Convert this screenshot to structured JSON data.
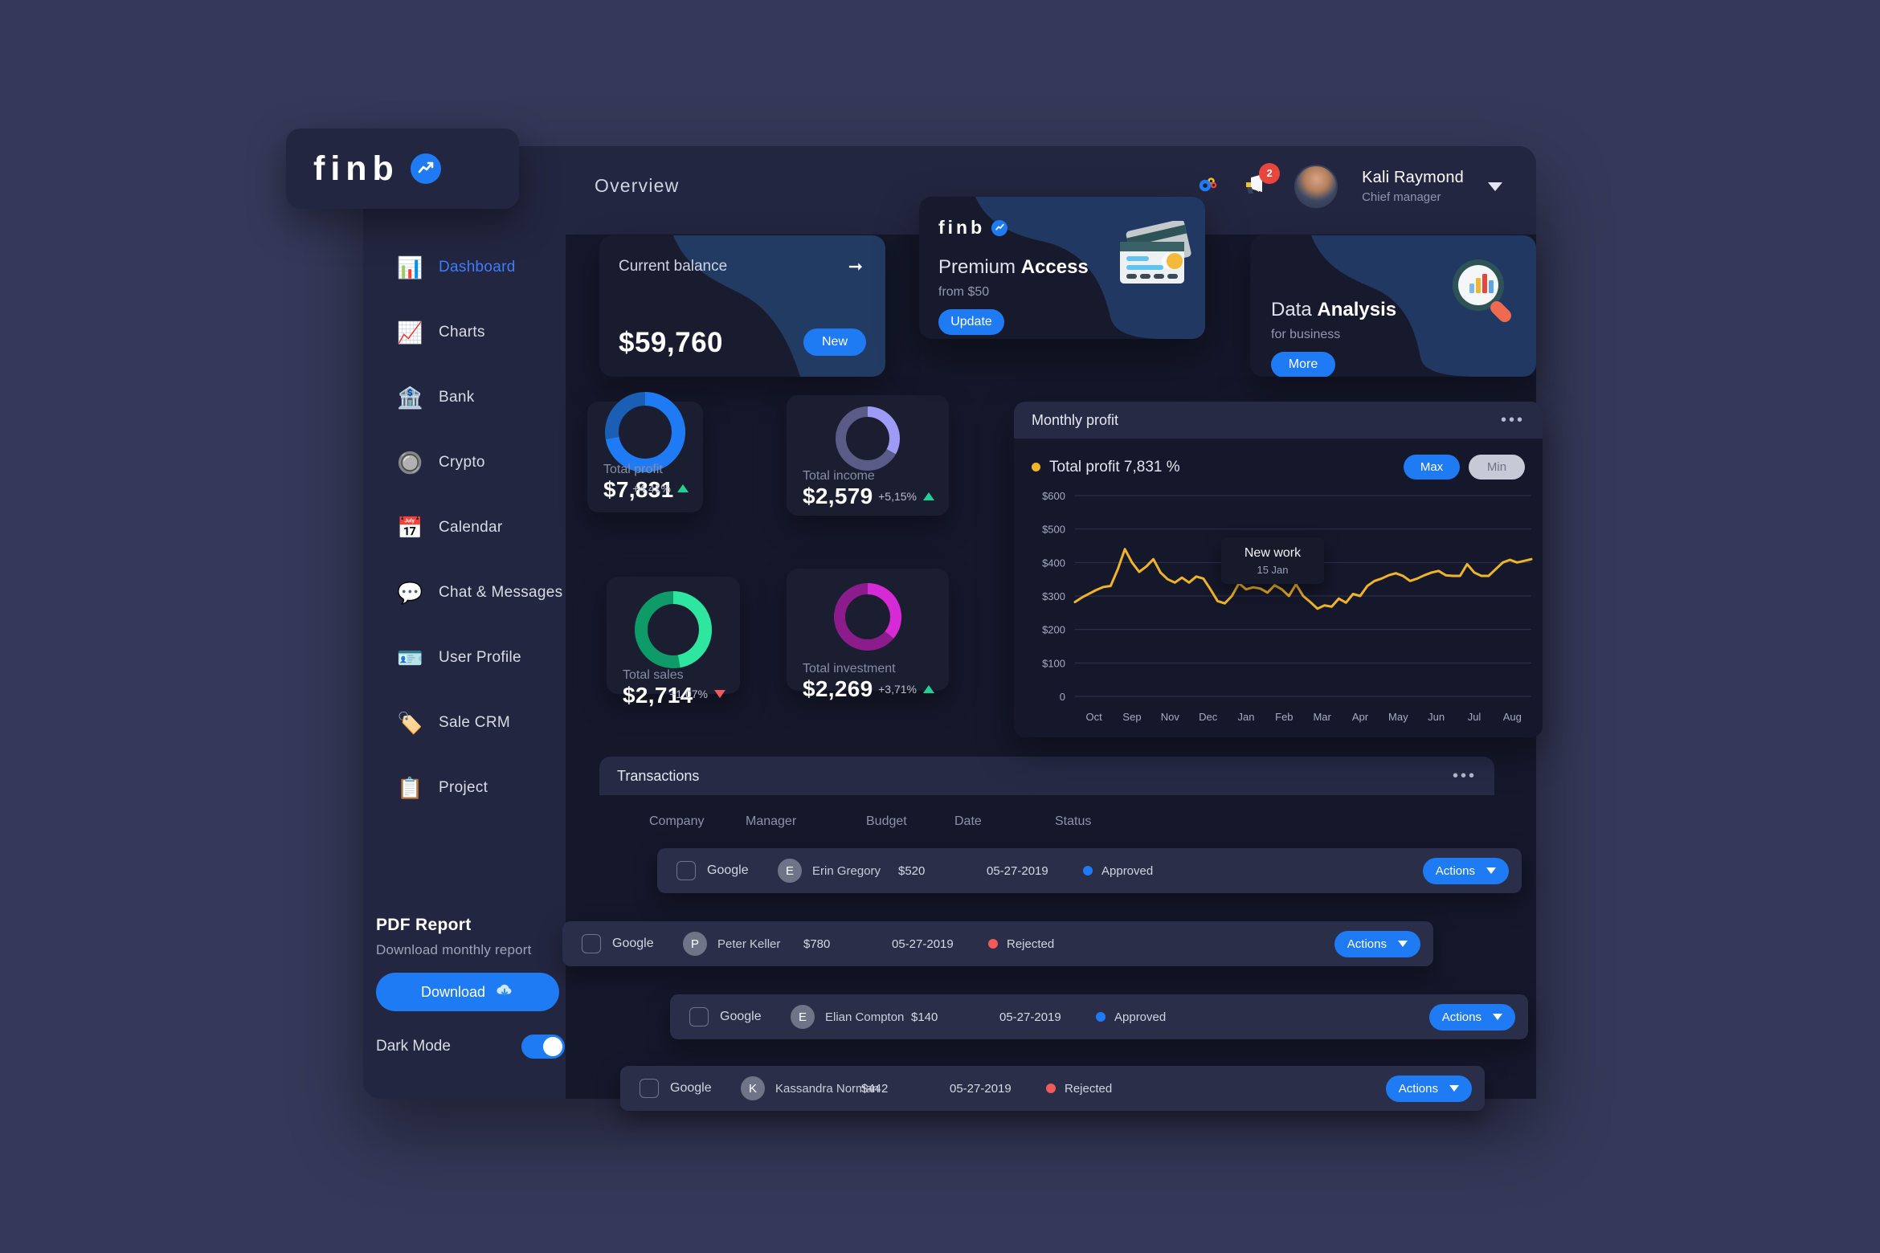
{
  "brand": {
    "name": "finb",
    "badge_icon": "trend-up-icon"
  },
  "header": {
    "page_title": "Overview",
    "settings_icon": "gears-icon",
    "notifications_icon": "megaphone-icon",
    "notification_count": "2",
    "user_name": "Kali Raymond",
    "user_role": "Chief manager",
    "avatar_icon": "user-avatar",
    "caret_icon": "chevron-down-icon"
  },
  "sidebar": {
    "items": [
      {
        "label": "Dashboard",
        "icon": "presentation-chart-icon",
        "glyph": "📊",
        "active": true
      },
      {
        "label": "Charts",
        "icon": "bar-chart-icon",
        "glyph": "📈",
        "active": false
      },
      {
        "label": "Bank",
        "icon": "bank-icon",
        "glyph": "🏦",
        "active": false
      },
      {
        "label": "Crypto",
        "icon": "crypto-cube-icon",
        "glyph": "🔘",
        "active": false
      },
      {
        "label": "Calendar",
        "icon": "calendar-icon",
        "glyph": "📅",
        "active": false
      },
      {
        "label": "Chat & Messages",
        "icon": "chat-bubbles-icon",
        "glyph": "💬",
        "active": false
      },
      {
        "label": "User Profile",
        "icon": "id-badge-icon",
        "glyph": "🪪",
        "active": false
      },
      {
        "label": "Sale CRM",
        "icon": "price-tag-icon",
        "glyph": "🏷️",
        "active": false
      },
      {
        "label": "Project",
        "icon": "clipboard-icon",
        "glyph": "📋",
        "active": false
      }
    ],
    "pdf": {
      "title": "PDF Report",
      "subtitle": "Download monthly report",
      "download_label": "Download",
      "download_icon": "cloud-download-icon"
    },
    "dark_mode": {
      "label": "Dark Mode",
      "enabled": true
    }
  },
  "cards": {
    "balance": {
      "label": "Current balance",
      "amount": "$59,760",
      "button_label": "New",
      "arrow_icon": "arrow-right-icon"
    },
    "premium": {
      "brand": "finb",
      "title_light": "Premium ",
      "title_bold": "Access",
      "subtitle": "from $50",
      "button_label": "Update",
      "illustration_icon": "credit-cards-icon"
    },
    "data_analysis": {
      "title_light": "Data ",
      "title_bold": "Analysis",
      "subtitle": "for business",
      "button_label": "More",
      "illustration_icon": "magnifier-chart-icon"
    }
  },
  "stats": [
    {
      "label": "Total profit",
      "value": "$7,831",
      "delta": "+4,41%",
      "direction": "up",
      "ring_color": "#1f7bf4",
      "ring_track": "#1a5fb4",
      "percent": 72
    },
    {
      "label": "Total income",
      "value": "$2,579",
      "delta": "+5,15%",
      "direction": "up",
      "ring_color": "#9d9bf5",
      "ring_track": "#5a5b86",
      "percent": 33
    },
    {
      "label": "Total sales",
      "value": "$2,714",
      "delta": "+1,07%",
      "direction": "down",
      "ring_color": "#2ee6a0",
      "ring_track": "#0f9b68",
      "percent": 47
    },
    {
      "label": "Total investment",
      "value": "$2,269",
      "delta": "+3,71%",
      "direction": "up",
      "ring_color": "#d62ad6",
      "ring_track": "#8c1b8c",
      "percent": 36
    }
  ],
  "chart_panel": {
    "title": "Monthly profit",
    "menu_icon": "more-horizontal-icon",
    "legend_label": "Total profit 7,831 %",
    "legend_color": "#f0b429",
    "button_max": "Max",
    "button_min": "Min",
    "tooltip_title": "New work",
    "tooltip_sub": "15 Jan"
  },
  "chart_data": {
    "type": "line",
    "title": "Monthly profit",
    "series_name": "Total profit",
    "series_color": "#f0b429",
    "xlabel": "",
    "ylabel": "",
    "ylim": [
      0,
      600
    ],
    "yticks": [
      "0",
      "$100",
      "$200",
      "$300",
      "$400",
      "$500",
      "$600"
    ],
    "grid": true,
    "legend_position": "top-left",
    "categories": [
      "Oct",
      "Sep",
      "Nov",
      "Dec",
      "Jan",
      "Feb",
      "Mar",
      "Apr",
      "May",
      "Jun",
      "Jul",
      "Aug"
    ],
    "annotation": {
      "label": "New work",
      "date": "15 Jan"
    },
    "values": [
      282,
      296,
      307,
      318,
      327,
      330,
      380,
      440,
      400,
      372,
      388,
      410,
      370,
      350,
      340,
      355,
      340,
      358,
      352,
      320,
      285,
      278,
      300,
      338,
      320,
      326,
      322,
      310,
      332,
      320,
      300,
      335,
      300,
      282,
      262,
      272,
      268,
      292,
      280,
      306,
      300,
      330,
      345,
      352,
      362,
      368,
      360,
      345,
      352,
      362,
      370,
      375,
      362,
      360,
      360,
      395,
      370,
      360,
      360,
      380,
      400,
      408,
      400,
      405,
      410
    ]
  },
  "transactions": {
    "title": "Transactions",
    "menu_icon": "more-horizontal-icon",
    "columns": [
      "Company",
      "Manager",
      "Budget",
      "Date",
      "Status"
    ],
    "action_label": "Actions",
    "action_caret_icon": "chevron-down-icon",
    "rows": [
      {
        "company": "Google",
        "manager": "Erin Gregory",
        "initial": "E",
        "budget": "$520",
        "date": "05-27-2019",
        "status": "Approved",
        "status_color": "#1f7bf4"
      },
      {
        "company": "Google",
        "manager": "Peter Keller",
        "initial": "P",
        "budget": "$780",
        "date": "05-27-2019",
        "status": "Rejected",
        "status_color": "#f05a5a"
      },
      {
        "company": "Google",
        "manager": "Elian Compton",
        "initial": "E",
        "budget": "$140",
        "date": "05-27-2019",
        "status": "Approved",
        "status_color": "#1f7bf4"
      },
      {
        "company": "Google",
        "manager": "Kassandra Norman",
        "initial": "K",
        "budget": "$442",
        "date": "05-27-2019",
        "status": "Rejected",
        "status_color": "#f05a5a"
      }
    ]
  },
  "colors": {
    "accent": "#1f7bf4",
    "background": "#353858",
    "panel": "#232640",
    "surface": "#15182b",
    "gold": "#f0b429"
  }
}
